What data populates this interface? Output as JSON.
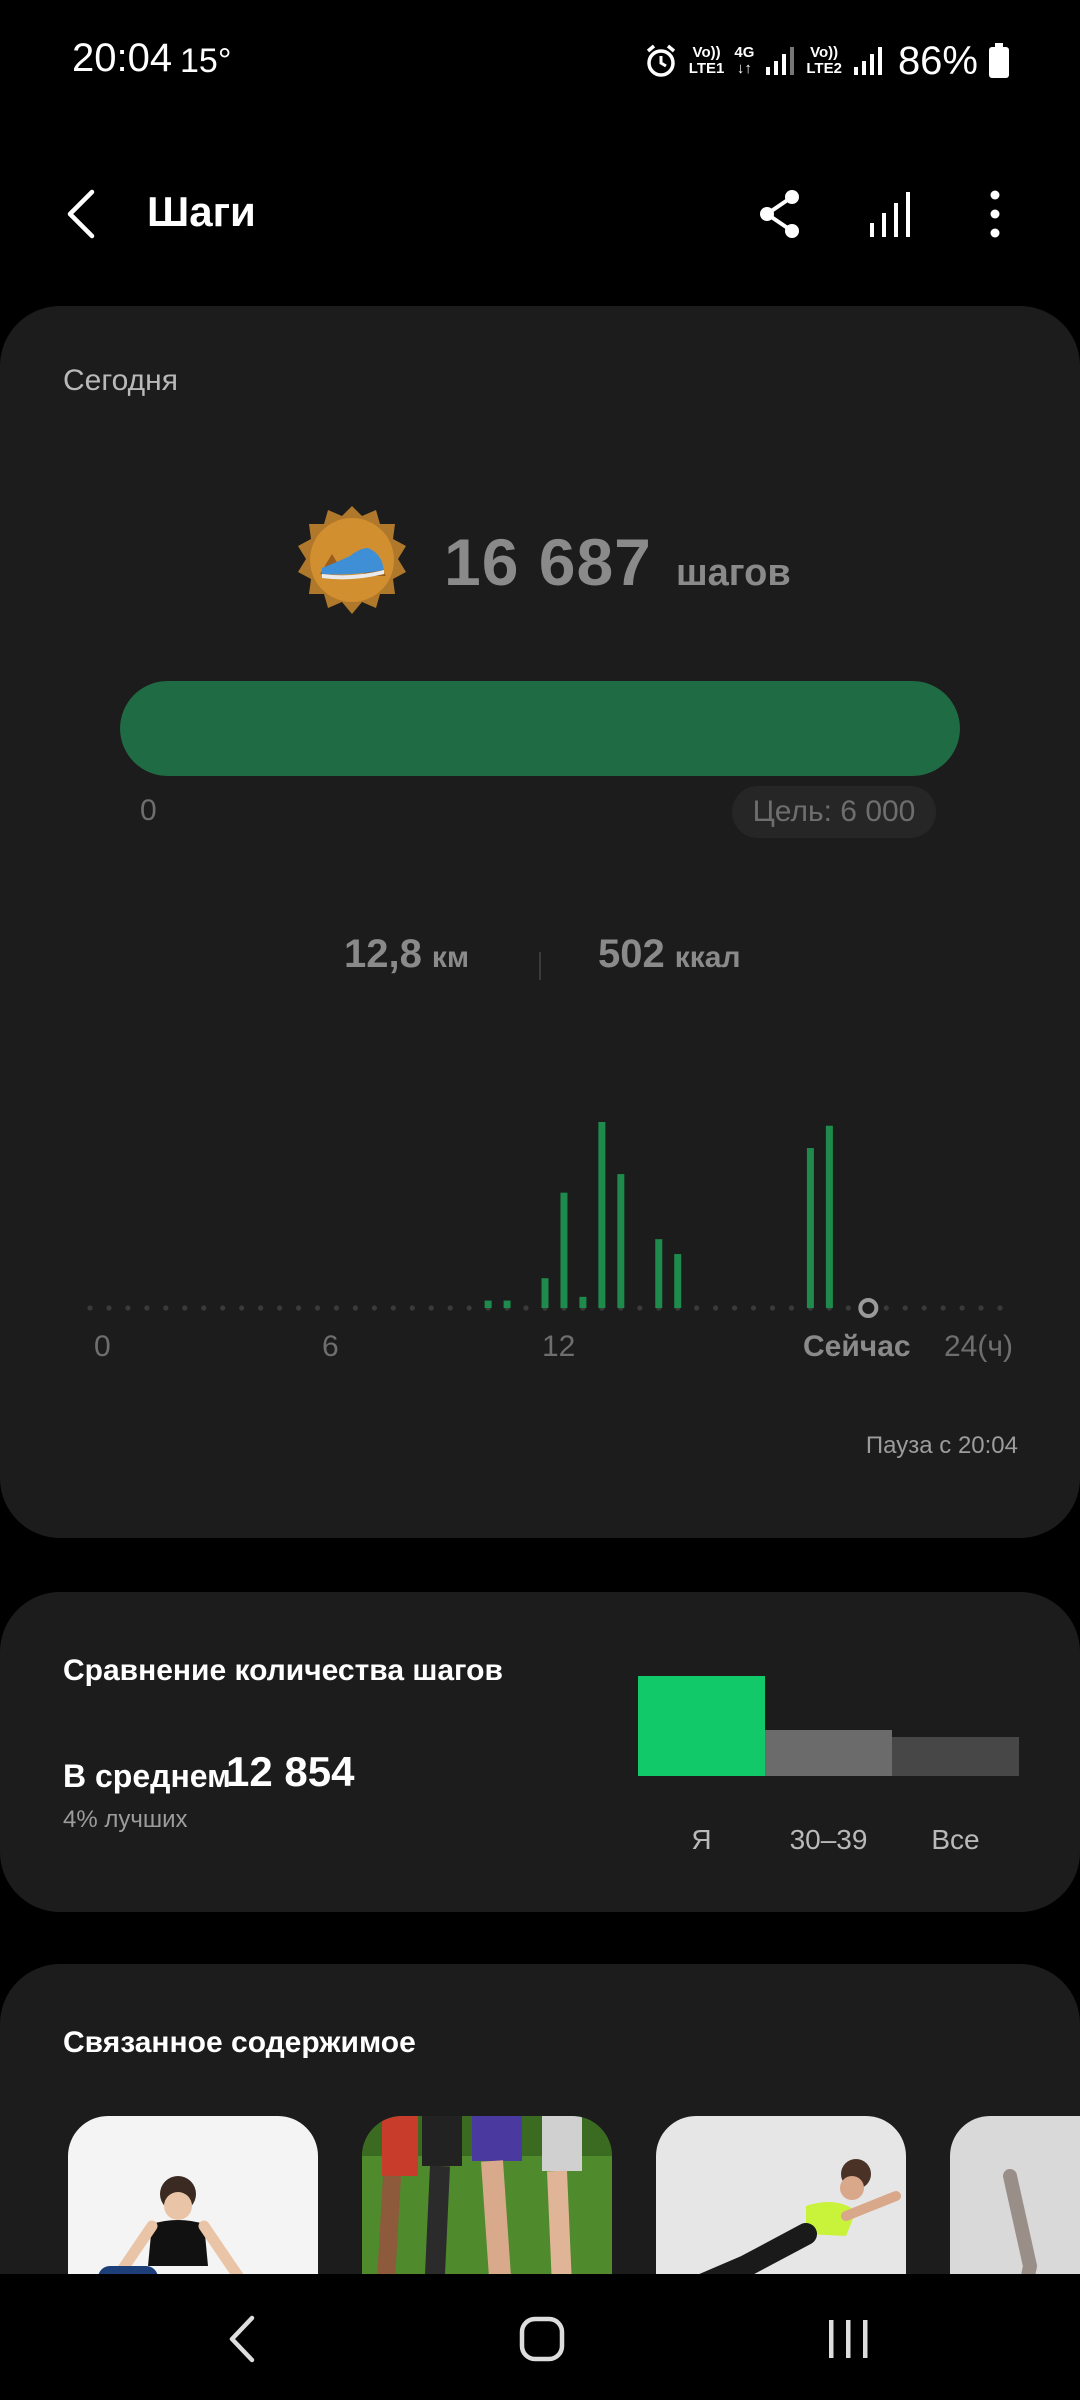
{
  "status_bar": {
    "time": "20:04",
    "temperature": "15°",
    "sim1_top": "Vo))",
    "sim1_bottom": "LTE1",
    "net_type": "4G",
    "sim2_top": "Vo))",
    "sim2_bottom": "LTE2",
    "battery": "86%"
  },
  "header": {
    "title": "Шаги",
    "icons": [
      "back-icon",
      "share-icon",
      "trends-icon",
      "more-icon"
    ]
  },
  "today": {
    "label": "Сегодня",
    "steps_value": "16 687",
    "steps_unit": "шагов",
    "progress_fraction": 1.0,
    "progress_start": "0",
    "goal": "Цель: 6 000",
    "distance_value": "12,8",
    "distance_unit": "км",
    "calories_value": "502",
    "calories_unit": "ккал",
    "pause_note": "Пауза с 20:04"
  },
  "chart_data": {
    "type": "bar",
    "x_ticks": [
      "0",
      "6",
      "12",
      "Сейчас",
      "24(ч)"
    ],
    "xlim": [
      0,
      24
    ],
    "current_hour": 20,
    "bars": [
      {
        "hour": 10.5,
        "value": 0.04
      },
      {
        "hour": 11.0,
        "value": 0.04
      },
      {
        "hour": 12.0,
        "value": 0.16
      },
      {
        "hour": 12.5,
        "value": 0.62
      },
      {
        "hour": 13.0,
        "value": 0.06
      },
      {
        "hour": 13.5,
        "value": 1.0
      },
      {
        "hour": 14.0,
        "value": 0.72
      },
      {
        "hour": 15.0,
        "value": 0.37
      },
      {
        "hour": 15.5,
        "value": 0.29
      },
      {
        "hour": 19.0,
        "value": 0.86
      },
      {
        "hour": 19.5,
        "value": 0.98
      }
    ],
    "color": "#1e8a4c",
    "dot_color": "#3a3a3a"
  },
  "compare": {
    "title": "Сравнение количества шагов",
    "avg_label": "В среднем",
    "avg_value": "12 854",
    "rank": "4% лучших",
    "groups": [
      {
        "label": "Я",
        "value": 1.0,
        "color": "#12c96a"
      },
      {
        "label": "30–39",
        "value": 0.46,
        "color": "#6b6b6b"
      },
      {
        "label": "Все",
        "value": 0.39,
        "color": "#474747"
      }
    ]
  },
  "related": {
    "title": "Связанное содержимое",
    "items": [
      "workout-thumbnail-1",
      "running-thumbnail",
      "workout-thumbnail-2",
      "workout-thumbnail-3"
    ]
  },
  "nav": {
    "icons": [
      "nav-back-icon",
      "nav-home-icon",
      "nav-recents-icon"
    ]
  }
}
